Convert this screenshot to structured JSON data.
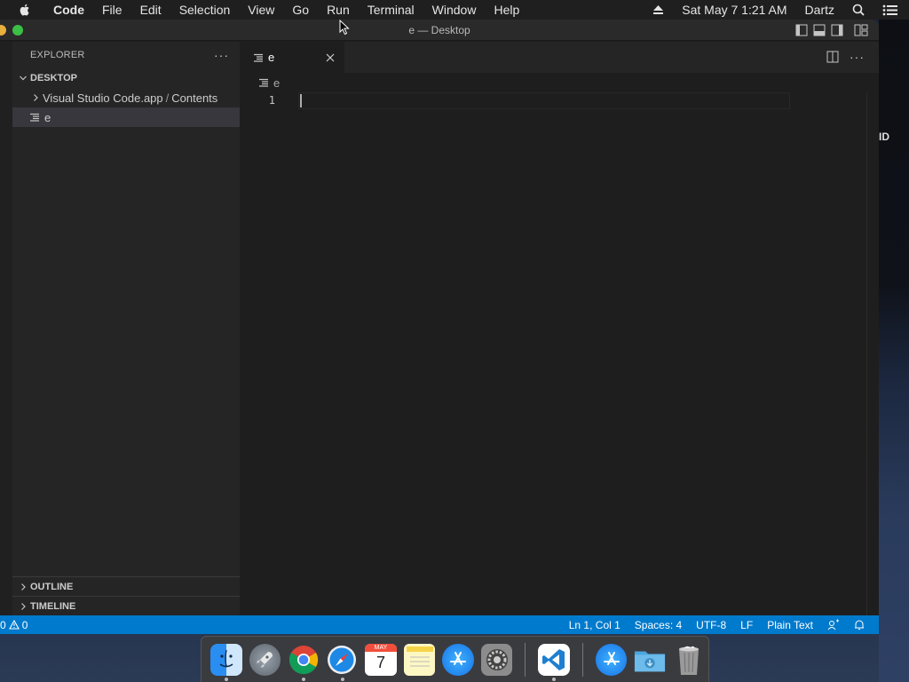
{
  "menubar": {
    "app_name": "Code",
    "menus": [
      "File",
      "Edit",
      "Selection",
      "View",
      "Go",
      "Run",
      "Terminal",
      "Window",
      "Help"
    ],
    "datetime": "Sat May 7  1:21 AM",
    "user": "Dartz"
  },
  "window": {
    "title": "e — Desktop"
  },
  "sidebar": {
    "header": "EXPLORER",
    "more": "···",
    "folder": "DESKTOP",
    "items": [
      {
        "name": "Visual Studio Code.app",
        "sep": "/",
        "sub": "Contents"
      },
      {
        "name": "e"
      }
    ],
    "outline": "OUTLINE",
    "timeline": "TIMELINE"
  },
  "editor": {
    "tab_label": "e",
    "breadcrumb": "e",
    "line_number": "1",
    "more": "···"
  },
  "statusbar": {
    "errors": "0",
    "warnings": "0",
    "position": "Ln 1, Col 1",
    "spaces": "Spaces: 4",
    "encoding": "UTF-8",
    "eol": "LF",
    "language": "Plain Text"
  },
  "desktop": {
    "ghost_text": "ID"
  },
  "dock": {
    "apps": [
      "finder",
      "launchpad",
      "chrome",
      "safari",
      "calendar",
      "notes",
      "app-store",
      "system-preferences",
      "vscode",
      "app-store-2",
      "downloads",
      "trash"
    ],
    "calendar_month": "MAY",
    "calendar_day": "7"
  }
}
